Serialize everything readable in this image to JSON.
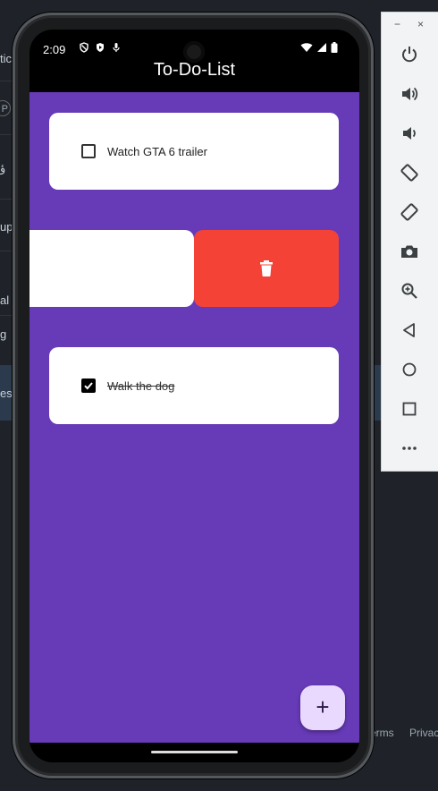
{
  "background_ide": {
    "fragments": [
      "tic",
      "P",
      "ؤ",
      "upl",
      "al",
      "g",
      "est"
    ],
    "footer_links": [
      "erms",
      "Privac"
    ]
  },
  "status_bar": {
    "time": "2:09",
    "icons": [
      "shield-icon",
      "play-protect-icon",
      "mic-icon",
      "wifi-icon",
      "signal-icon",
      "battery-icon"
    ]
  },
  "app_bar": {
    "title": "To-Do-List"
  },
  "tasks": [
    {
      "text": "Watch GTA 6 trailer",
      "checked": false
    },
    {
      "text": "",
      "checked": false,
      "swiping": true
    },
    {
      "text": "Walk the dog",
      "checked": true
    }
  ],
  "delete_action": {
    "icon": "trash-icon",
    "color": "#f44336"
  },
  "fab": {
    "label": "+"
  },
  "emulator_toolbar": {
    "window_controls": [
      "−",
      "×"
    ],
    "buttons": [
      "power-icon",
      "volume-up-icon",
      "volume-down-icon",
      "rotate-left-icon",
      "rotate-right-icon",
      "camera-icon",
      "zoom-icon",
      "back-icon",
      "home-icon",
      "overview-icon",
      "more-icon"
    ]
  },
  "colors": {
    "primary": "#673ab7",
    "card": "#ffffff",
    "delete": "#f44336",
    "fab": "#ead9ff"
  }
}
